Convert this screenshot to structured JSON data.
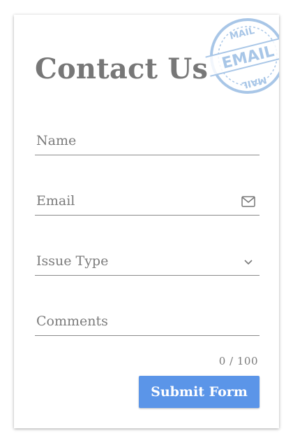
{
  "form": {
    "title": "Contact Us",
    "name_placeholder": "Name",
    "email_placeholder": "Email",
    "issue_placeholder": "Issue Type",
    "comments_placeholder": "Comments",
    "comments_counter": "0 / 100",
    "submit_label": "Submit Form"
  },
  "stamp": {
    "text_main": "EMAIL",
    "text_ring": "MAIL",
    "color": "#8cb4e0"
  },
  "colors": {
    "accent": "#5b95e8",
    "title": "#777777",
    "placeholder": "#7b7b7b"
  }
}
